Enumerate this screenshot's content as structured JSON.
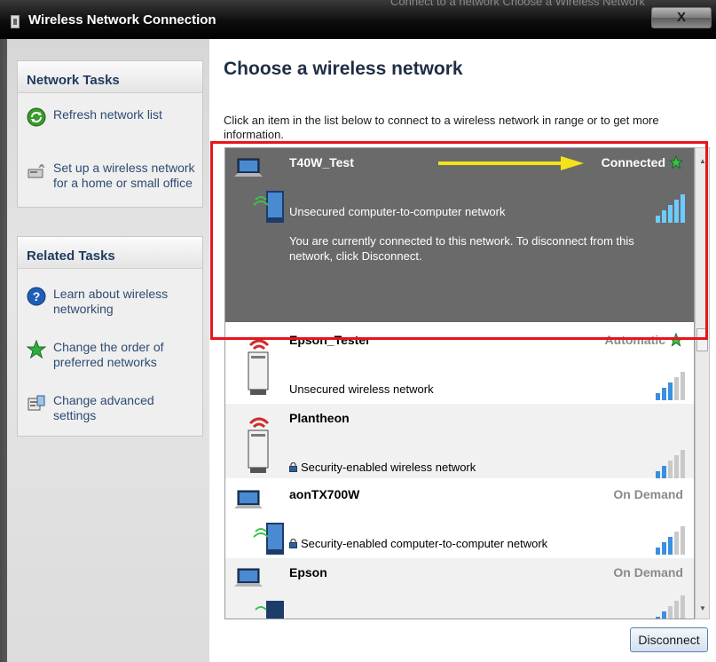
{
  "window": {
    "title": "Wireless Network Connection",
    "close_label": "X",
    "bg_fragment": "Connect to a network  Choose a Wireless Network"
  },
  "network_tasks": {
    "header": "Network Tasks",
    "items": [
      {
        "label": "Refresh network list",
        "icon": "refresh-icon"
      },
      {
        "label": "Set up a wireless network for a home or small office",
        "icon": "setup-network-icon"
      }
    ]
  },
  "related_tasks": {
    "header": "Related Tasks",
    "items": [
      {
        "label": "Learn about wireless networking",
        "icon": "help-icon"
      },
      {
        "label": "Change the order of preferred networks",
        "icon": "star-icon"
      },
      {
        "label": "Change advanced settings",
        "icon": "settings-icon"
      }
    ]
  },
  "main": {
    "title": "Choose a wireless network",
    "description": "Click an item in the list below to connect to a wireless network in range or to get more information."
  },
  "networks": [
    {
      "name": "T40W_Test",
      "status": "Connected",
      "type": "Unsecured computer-to-computer network",
      "message": "You are currently connected to this network. To disconnect from this network, click Disconnect.",
      "selected": true,
      "secured": false,
      "signal_bars": 5
    },
    {
      "name": "Epson_Tester",
      "status": "Automatic",
      "type": "Unsecured wireless network",
      "secured": false,
      "signal_bars": 3
    },
    {
      "name": "Plantheon",
      "status": "",
      "type": "Security-enabled wireless network",
      "secured": true,
      "signal_bars": 2
    },
    {
      "name": "aonTX700W",
      "status": "On Demand",
      "type": "Security-enabled computer-to-computer network",
      "secured": true,
      "signal_bars": 3
    },
    {
      "name": "Epson",
      "status": "On Demand",
      "type": "",
      "secured": false,
      "signal_bars": 2
    }
  ],
  "buttons": {
    "disconnect": "Disconnect"
  },
  "colors": {
    "highlight_box": "#e8141c",
    "annotation_arrow": "#f5e31a",
    "selected_row": "#6a6a6a",
    "title_text": "#1f2e45",
    "link_text": "#2d4b73"
  }
}
